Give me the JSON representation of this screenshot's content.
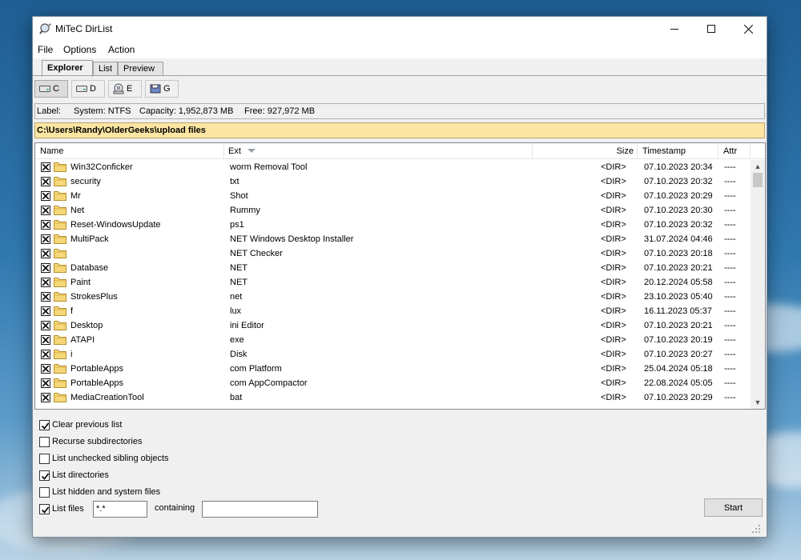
{
  "window": {
    "title": "MiTeC DirList",
    "minimize_glyph": "—",
    "maximize_glyph": "☐",
    "close_glyph": "✕"
  },
  "menu": [
    "File",
    "Options",
    "Action"
  ],
  "tabs": [
    {
      "label": "Explorer",
      "active": true
    },
    {
      "label": "List",
      "active": false
    },
    {
      "label": "Preview",
      "active": false
    }
  ],
  "drives": [
    {
      "label": "C",
      "icon": "hard-drive-icon",
      "selected": true
    },
    {
      "label": "D",
      "icon": "hard-drive-icon",
      "selected": false
    },
    {
      "label": "E",
      "icon": "optical-drive-icon",
      "selected": false
    },
    {
      "label": "G",
      "icon": "removable-drive-icon",
      "selected": false
    }
  ],
  "drive_info": {
    "label": "Label:",
    "system": "System: NTFS",
    "capacity": "Capacity: 1,952,873 MB",
    "free": "Free: 927,972 MB"
  },
  "path": "C:\\Users\\Randy\\OlderGeeks\\upload files",
  "columns": [
    "Name",
    "Ext",
    "Size",
    "Timestamp",
    "Attr"
  ],
  "rows": [
    {
      "name": "Win32Conficker",
      "ext": "worm Removal Tool",
      "size": "<DIR>",
      "timestamp": "07.10.2023 20:34",
      "attr": "----"
    },
    {
      "name": "security",
      "ext": "txt",
      "size": "<DIR>",
      "timestamp": "07.10.2023 20:32",
      "attr": "----"
    },
    {
      "name": "Mr",
      "ext": "Shot",
      "size": "<DIR>",
      "timestamp": "07.10.2023 20:29",
      "attr": "----"
    },
    {
      "name": "Net",
      "ext": "Rummy",
      "size": "<DIR>",
      "timestamp": "07.10.2023 20:30",
      "attr": "----"
    },
    {
      "name": "Reset-WindowsUpdate",
      "ext": "ps1",
      "size": "<DIR>",
      "timestamp": "07.10.2023 20:32",
      "attr": "----"
    },
    {
      "name": "MultiPack",
      "ext": "NET Windows Desktop Installer",
      "size": "<DIR>",
      "timestamp": "31.07.2024 04:46",
      "attr": "----"
    },
    {
      "name": "",
      "ext": "NET Checker",
      "size": "<DIR>",
      "timestamp": "07.10.2023 20:18",
      "attr": "----"
    },
    {
      "name": "Database",
      "ext": "NET",
      "size": "<DIR>",
      "timestamp": "07.10.2023 20:21",
      "attr": "----"
    },
    {
      "name": "Paint",
      "ext": "NET",
      "size": "<DIR>",
      "timestamp": "20.12.2024 05:58",
      "attr": "----"
    },
    {
      "name": "StrokesPlus",
      "ext": "net",
      "size": "<DIR>",
      "timestamp": "23.10.2023 05:40",
      "attr": "----"
    },
    {
      "name": "f",
      "ext": "lux",
      "size": "<DIR>",
      "timestamp": "16.11.2023 05:37",
      "attr": "----"
    },
    {
      "name": "Desktop",
      "ext": "ini Editor",
      "size": "<DIR>",
      "timestamp": "07.10.2023 20:21",
      "attr": "----"
    },
    {
      "name": "ATAPI",
      "ext": "exe",
      "size": "<DIR>",
      "timestamp": "07.10.2023 20:19",
      "attr": "----"
    },
    {
      "name": "i",
      "ext": "Disk",
      "size": "<DIR>",
      "timestamp": "07.10.2023 20:27",
      "attr": "----"
    },
    {
      "name": "PortableApps",
      "ext": "com Platform",
      "size": "<DIR>",
      "timestamp": "25.04.2024 05:18",
      "attr": "----"
    },
    {
      "name": "PortableApps",
      "ext": "com AppCompactor",
      "size": "<DIR>",
      "timestamp": "22.08.2024 05:05",
      "attr": "----"
    },
    {
      "name": "MediaCreationTool",
      "ext": "bat",
      "size": "<DIR>",
      "timestamp": "07.10.2023 20:29",
      "attr": "----"
    }
  ],
  "options": [
    {
      "label": "Clear previous list",
      "checked": true
    },
    {
      "label": "Recurse subdirectories",
      "checked": false
    },
    {
      "label": "List unchecked sibling objects",
      "checked": false
    },
    {
      "label": "List directories",
      "checked": true
    },
    {
      "label": "List hidden and system files",
      "checked": false
    },
    {
      "label": "List files",
      "checked": true
    }
  ],
  "filter": {
    "mask": "*.*",
    "containing_label": "containing",
    "containing_value": ""
  },
  "start_label": "Start"
}
